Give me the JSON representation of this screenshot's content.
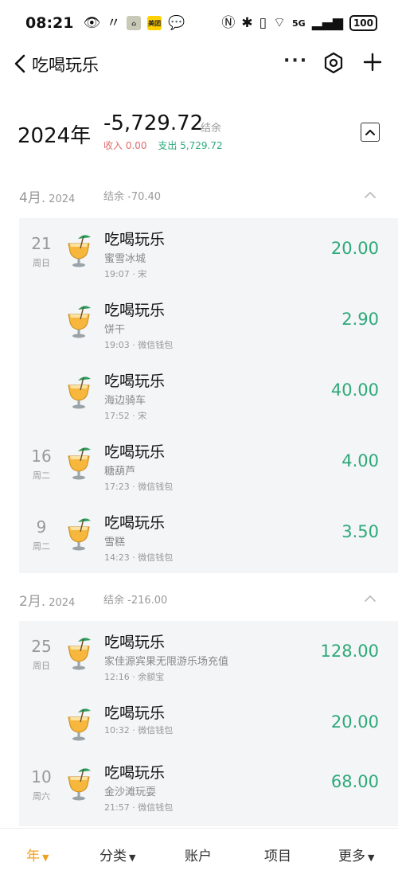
{
  "status_bar": {
    "time": "08:21",
    "badge_meituan": "美团",
    "signal": "5G",
    "battery": "100"
  },
  "nav": {
    "title": "吃喝玩乐",
    "more_label": "···"
  },
  "summary": {
    "year": "2024年",
    "balance": "-5,729.72",
    "balance_label": "结余",
    "income": "收入 0.00",
    "expense": "支出 5,729.72"
  },
  "months": [
    {
      "month": "4月.",
      "year": "2024",
      "balance": "结余 -70.40",
      "transactions": [
        {
          "day": "21",
          "weekday": "周日",
          "category": "吃喝玩乐",
          "note": "蜜雪冰城",
          "meta": "19:07 · 宋",
          "amount": "20.00"
        },
        {
          "day": "",
          "weekday": "",
          "category": "吃喝玩乐",
          "note": "饼干",
          "meta": "19:03 · 微信钱包",
          "amount": "2.90"
        },
        {
          "day": "",
          "weekday": "",
          "category": "吃喝玩乐",
          "note": "海边骑车",
          "meta": "17:52 · 宋",
          "amount": "40.00"
        },
        {
          "day": "16",
          "weekday": "周二",
          "category": "吃喝玩乐",
          "note": "糖葫芦",
          "meta": "17:23 · 微信钱包",
          "amount": "4.00"
        },
        {
          "day": "9",
          "weekday": "周二",
          "category": "吃喝玩乐",
          "note": "雪糕",
          "meta": "14:23 · 微信钱包",
          "amount": "3.50"
        }
      ]
    },
    {
      "month": "2月.",
      "year": "2024",
      "balance": "结余 -216.00",
      "transactions": [
        {
          "day": "25",
          "weekday": "周日",
          "category": "吃喝玩乐",
          "note": "家佳源宾果无限游乐场充值",
          "meta": "12:16 · 余额宝",
          "amount": "128.00"
        },
        {
          "day": "",
          "weekday": "",
          "category": "吃喝玩乐",
          "note": "",
          "meta": "10:32 · 微信钱包",
          "amount": "20.00"
        },
        {
          "day": "10",
          "weekday": "周六",
          "category": "吃喝玩乐",
          "note": "金沙滩玩耍",
          "meta": "21:57 · 微信钱包",
          "amount": "68.00"
        }
      ]
    }
  ],
  "tabs": [
    {
      "label": "年",
      "caret": "▼",
      "active": true
    },
    {
      "label": "分类",
      "caret": "▼",
      "active": false
    },
    {
      "label": "账户",
      "caret": "",
      "active": false
    },
    {
      "label": "项目",
      "caret": "",
      "active": false
    },
    {
      "label": "更多",
      "caret": "▼",
      "active": false
    }
  ],
  "colors": {
    "expense_green": "#2fa97a",
    "income_red": "#e06b6b",
    "active_tab": "#f0a020",
    "card_bg": "#f3f5f6"
  },
  "icons": {
    "category": "cocktail-icon"
  }
}
